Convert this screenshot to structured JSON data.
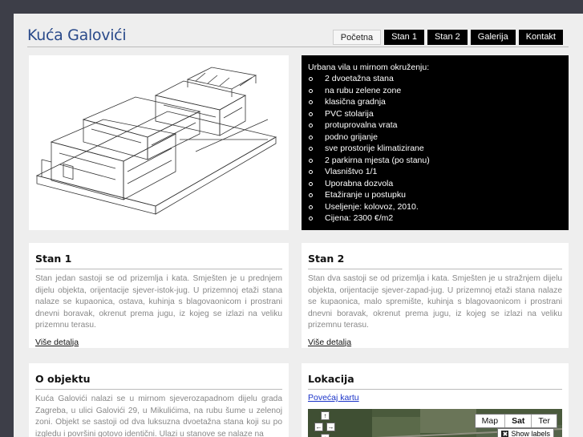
{
  "header": {
    "title": "Kuća Galovići",
    "nav": [
      {
        "label": "Početna",
        "active": true
      },
      {
        "label": "Stan 1",
        "active": false
      },
      {
        "label": "Stan 2",
        "active": false
      },
      {
        "label": "Galerija",
        "active": false
      },
      {
        "label": "Kontakt",
        "active": false
      }
    ]
  },
  "features": {
    "intro": "Urbana vila u mirnom okruženju:",
    "items": [
      "2 dvoetažna stana",
      "na rubu zelene zone",
      "klasična gradnja",
      "PVC stolarija",
      "protuprovalna vrata",
      "podno grijanje",
      "sve prostorije klimatizirane",
      "2 parkirna mjesta (po stanu)",
      "Vlasništvo 1/1",
      "Uporabna dozvola",
      "Etažiranje u postupku",
      "Useljenje: kolovoz, 2010.",
      "Cijena: 2300 €/m2"
    ]
  },
  "stan1": {
    "title": "Stan 1",
    "text": "Stan jedan sastoji se od prizemlja i kata. Smješten je u prednjem dijelu objekta, orijentacije sjever-istok-jug. U prizemnoj etaži stana nalaze se kupaonica, ostava, kuhinja s blagovaonicom i prostrani dnevni boravak, okrenut prema jugu, iz kojeg se izlazi na veliku prizemnu terasu.",
    "more": "Više detalja"
  },
  "stan2": {
    "title": "Stan 2",
    "text": "Stan dva sastoji se od prizemlja i kata. Smješten je u stražnjem dijelu objekta, orijentacije sjever-zapad-jug. U prizemnoj etaži stana nalaze se kupaonica, malo spremište, kuhinja s blagovaonicom i prostrani dnevni boravak, okrenut prema jugu, iz kojeg se izlazi na veliku prizemnu terasu.",
    "more": "Više detalja"
  },
  "objekt": {
    "title": "O objektu",
    "text": "Kuća Galovići nalazi se u mirnom sjeverozapadnom dijelu grada Zagreba, u ulici Galovići 29, u Mikulićima, na rubu šume u zelenoj zoni. Objekt se sastoji od dva luksuzna dvoetažna stana koji su po izgledu i površini gotovo identični. Ulazi u stanove se nalaze na"
  },
  "lokacija": {
    "title": "Lokacija",
    "link": "Povećaj kartu",
    "map_types": [
      "Map",
      "Sat",
      "Ter"
    ],
    "selected_map_type": "Sat",
    "show_labels": "Show labels"
  }
}
